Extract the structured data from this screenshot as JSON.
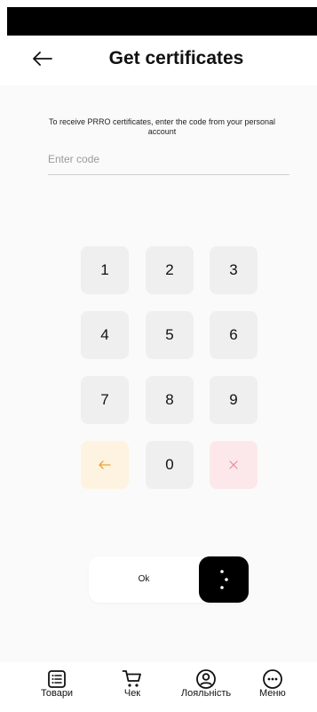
{
  "header": {
    "title": "Get certificates"
  },
  "form": {
    "instruction": "To receive PRRO certificates, enter the code from your personal account",
    "code_placeholder": "Enter code",
    "code_value": ""
  },
  "keypad": {
    "keys": [
      "1",
      "2",
      "3",
      "4",
      "5",
      "6",
      "7",
      "8",
      "9"
    ],
    "zero": "0"
  },
  "confirm": {
    "label": "Ok"
  },
  "bottom_nav": {
    "items": [
      {
        "label": "Товари",
        "icon": "list-icon"
      },
      {
        "label": "Чек",
        "icon": "cart-icon"
      },
      {
        "label": "Лояльність",
        "icon": "user-circle-icon"
      },
      {
        "label": "Меню",
        "icon": "more-icon"
      }
    ]
  },
  "colors": {
    "background": "#fafafa",
    "key_background": "#efefef",
    "backspace_key": "#fdf3e0",
    "backspace_accent": "#e8a53c",
    "clear_key": "#fce8ea",
    "clear_accent": "#e98a94",
    "slider_handle": "#000000"
  }
}
